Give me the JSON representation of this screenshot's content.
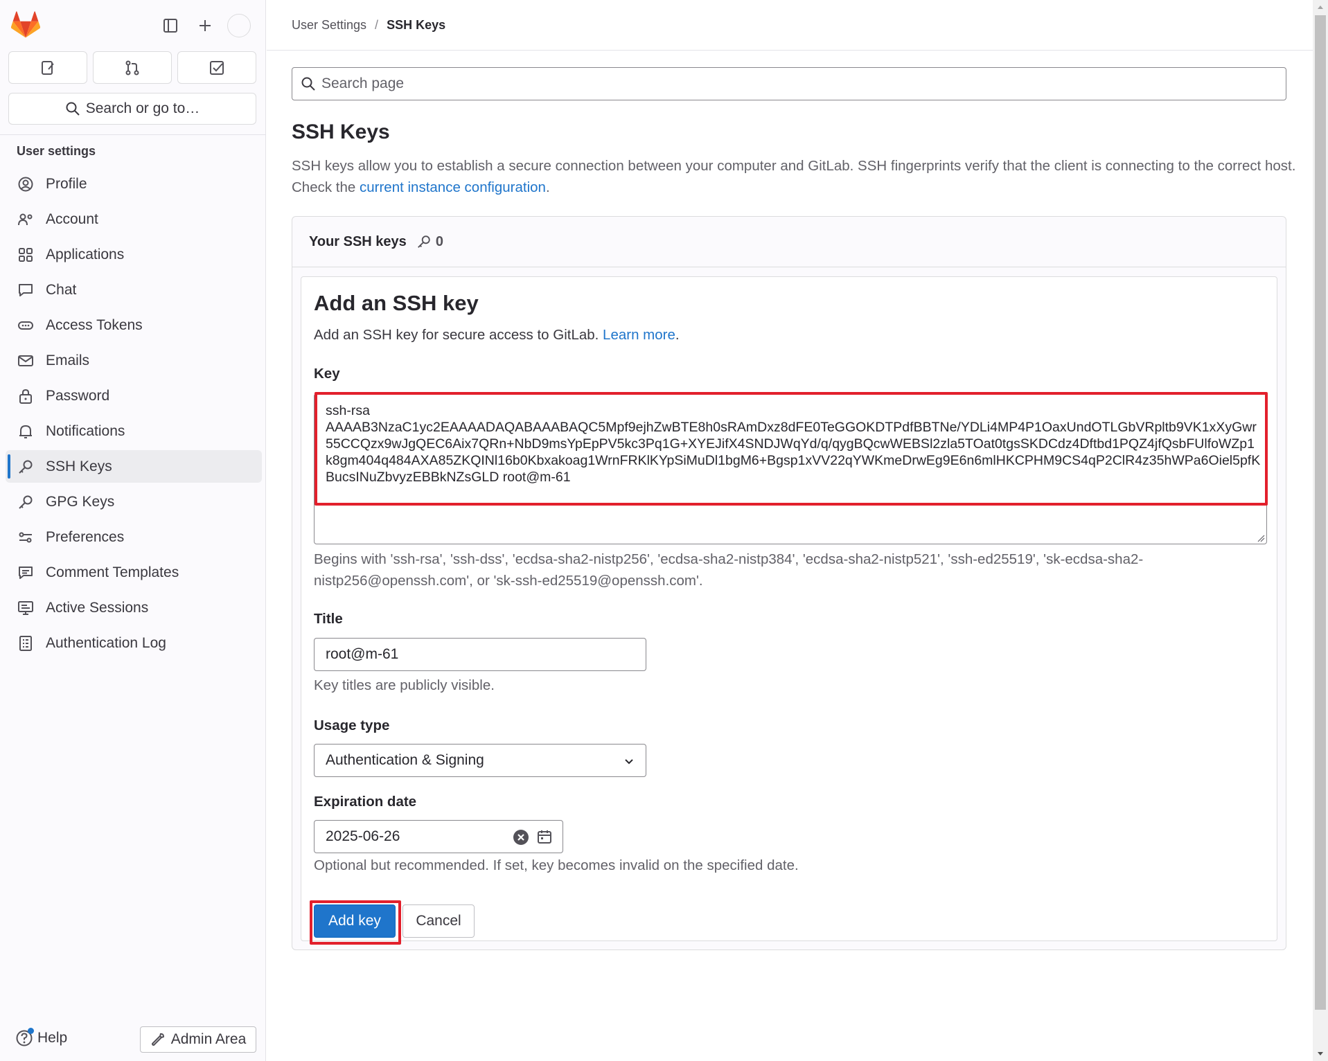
{
  "sidebar": {
    "search_label": "Search or go to…",
    "heading": "User settings",
    "items": [
      {
        "label": "Profile",
        "icon": "profile-icon"
      },
      {
        "label": "Account",
        "icon": "account-icon"
      },
      {
        "label": "Applications",
        "icon": "applications-icon"
      },
      {
        "label": "Chat",
        "icon": "chat-icon"
      },
      {
        "label": "Access Tokens",
        "icon": "token-icon"
      },
      {
        "label": "Emails",
        "icon": "email-icon"
      },
      {
        "label": "Password",
        "icon": "lock-icon"
      },
      {
        "label": "Notifications",
        "icon": "bell-icon"
      },
      {
        "label": "SSH Keys",
        "icon": "key-icon",
        "active": true
      },
      {
        "label": "GPG Keys",
        "icon": "key-icon"
      },
      {
        "label": "Preferences",
        "icon": "preferences-icon"
      },
      {
        "label": "Comment Templates",
        "icon": "comment-icon"
      },
      {
        "label": "Active Sessions",
        "icon": "monitor-icon"
      },
      {
        "label": "Authentication Log",
        "icon": "log-icon"
      }
    ],
    "help_label": "Help",
    "admin_label": "Admin Area"
  },
  "breadcrumb": {
    "parent": "User Settings",
    "separator": "/",
    "current": "SSH Keys"
  },
  "page_search": {
    "placeholder": "Search page"
  },
  "page": {
    "title": "SSH Keys",
    "desc_before": "SSH keys allow you to establish a secure connection between your computer and GitLab. SSH fingerprints verify that the client is connecting to the correct host. Check the ",
    "desc_link": "current instance configuration",
    "desc_after": "."
  },
  "card": {
    "title": "Your SSH keys",
    "count": "0"
  },
  "form": {
    "title": "Add an SSH key",
    "subtitle_before": "Add an SSH key for secure access to GitLab. ",
    "subtitle_link": "Learn more",
    "subtitle_after": ".",
    "key_label": "Key",
    "key_value": "ssh-rsa\nAAAAB3NzaC1yc2EAAAADAQABAAABAQC5Mpf9ejhZwBTE8h0sRAmDxz8dFE0TeGGOKDTPdfBBTNe/YDLi4MP4P1OaxUndOTLGbVRpltb9VK1xXyGwr55CCQzx9wJgQEC6Aix7QRn+NbD9msYpEpPV5kc3Pq1G+XYEJifX4SNDJWqYd/q/qygBQcwWEBSl2zla5TOat0tgsSKDCdz4Dftbd1PQZ4jfQsbFUlfoWZp1k8gm404q484AXA85ZKQINl16b0Kbxakoag1WrnFRKlKYpSiMuDl1bgM6+Bgsp1xVV22qYWKmeDrwEg9E6n6mlHKCPHM9CS4qP2ClR4z35hWPa6Oiel5pfKBucsINuZbvyzEBBkNZsGLD root@m-61",
    "key_help": "Begins with 'ssh-rsa', 'ssh-dss', 'ecdsa-sha2-nistp256', 'ecdsa-sha2-nistp384', 'ecdsa-sha2-nistp521', 'ssh-ed25519', 'sk-ecdsa-sha2-nistp256@openssh.com', or 'sk-ssh-ed25519@openssh.com'.",
    "title_label": "Title",
    "title_value": "root@m-61",
    "title_help": "Key titles are publicly visible.",
    "usage_label": "Usage type",
    "usage_value": "Authentication & Signing",
    "expiration_label": "Expiration date",
    "expiration_value": "2025-06-26",
    "expiration_help": "Optional but recommended. If set, key becomes invalid on the specified date.",
    "add_label": "Add key",
    "cancel_label": "Cancel"
  },
  "colors": {
    "accent": "#1f75cb",
    "highlight": "#e2202c",
    "logo_orange": "#fc6d26"
  }
}
